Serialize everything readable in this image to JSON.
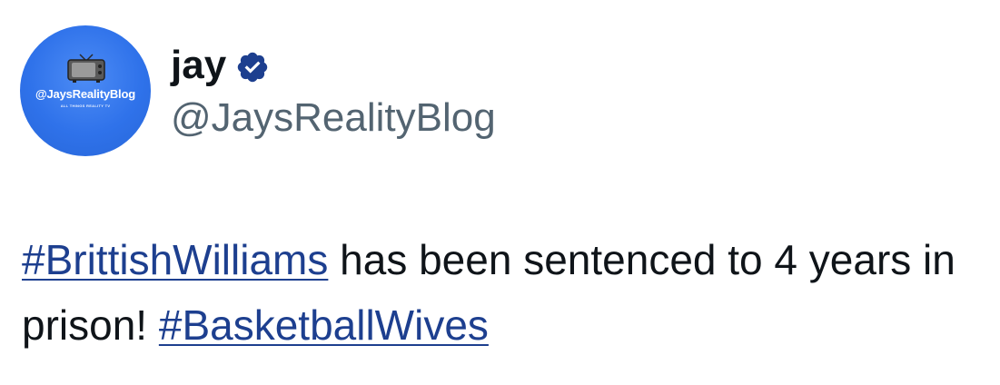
{
  "author": {
    "display_name": "jay",
    "handle": "@JaysRealityBlog",
    "verified": true,
    "verified_icon": "verified-badge-icon",
    "avatar": {
      "text": "@JaysRealityBlog",
      "subtext": "ALL THINGS REALITY TV",
      "background_color": "#2f72ea",
      "icon": "retro-tv-icon"
    }
  },
  "tweet": {
    "hashtag_1": "#BrittishWilliams",
    "text_1": " has been sentenced to 4 years in prison! ",
    "hashtag_2": "#BasketballWives"
  },
  "colors": {
    "text": "#0f1419",
    "handle": "#536471",
    "hashtag": "#1d3f8f",
    "verified_badge": "#1d3f8f"
  }
}
